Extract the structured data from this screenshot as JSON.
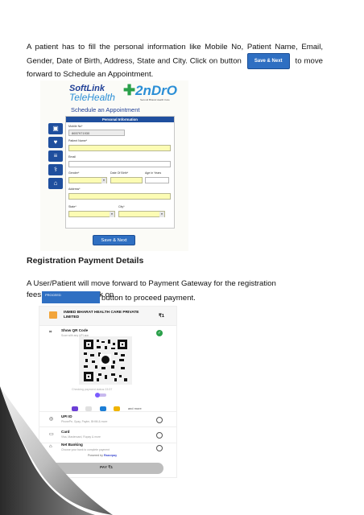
{
  "intro": {
    "text_before": "A patient has to fill the personal information like Mobile No, Patient Name, Email, Gender, Date of Birth, Address, State and City. Click on button",
    "button_label": "Save & Next",
    "text_after": "to move forward to Schedule an Appointment."
  },
  "form_screen": {
    "brand_line1": "SoftLink",
    "brand_line2": "TeleHealth",
    "brand_2ndro": "2nDrO",
    "brand_tagline": "Second Bharat Health Care",
    "title": "Schedule an Appointment",
    "panel_header": "Personal Information",
    "fields": {
      "mobile_label": "Mobile No*",
      "mobile_value": "8657971930",
      "patient_label": "Patient Name*",
      "email_label": "Email",
      "gender_label": "Gender*",
      "dob_label": "Date Of Birth*",
      "age_label": "Age in Years",
      "address_label": "Address*",
      "state_label": "State*",
      "city_label": "City*"
    },
    "submit_label": "Save & Next"
  },
  "section": {
    "heading": "Registration Payment Details",
    "text_line1": "A User/Patient will move forward to Payment Gateway for the registration fees.User/Patient click on",
    "proceed_label": "PROCEED",
    "text_line2": "button to proceed payment."
  },
  "payment_screen": {
    "merchant": "INMED BHARAT HEALTH CARE PRIVATE LIMITED",
    "amount": "₹1",
    "qr_title": "Show QR Code",
    "qr_sub": "Scan with any UPI app",
    "status_text": "Checking payment status  03:57",
    "and_more": "and more",
    "options": [
      {
        "title": "UPI ID",
        "sub": "PhonePe, Gpay, Paytm, BHIM & more"
      },
      {
        "title": "Card",
        "sub": "Visa, Mastercard, Rupay & more"
      },
      {
        "title": "Net Banking",
        "sub": "Choose your bank to complete payment"
      }
    ],
    "powered_prefix": "Powered by",
    "powered_brand": "Razorpay",
    "pay_label": "PAY ₹1"
  }
}
